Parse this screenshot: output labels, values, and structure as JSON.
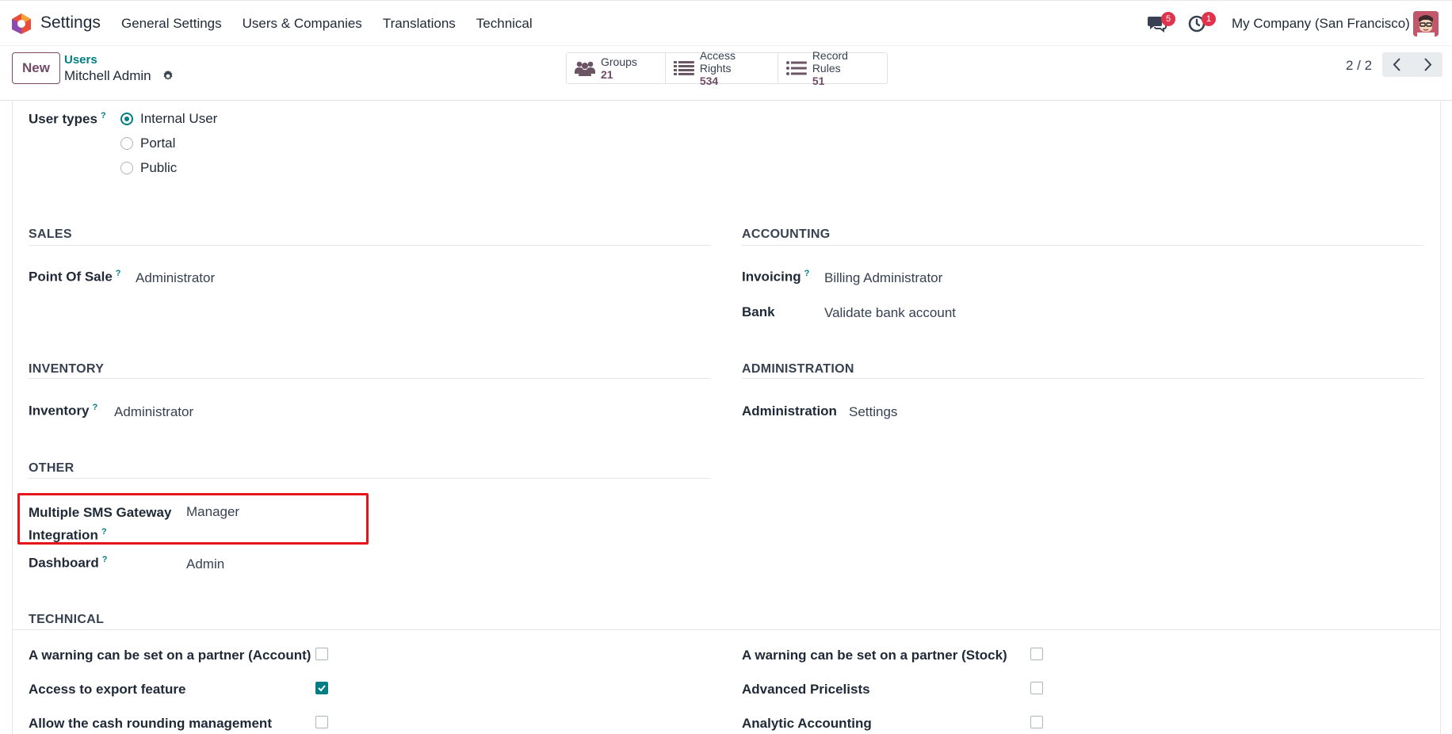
{
  "navbar": {
    "app_title": "Settings",
    "menu": [
      "General Settings",
      "Users & Companies",
      "Translations",
      "Technical"
    ],
    "chat_count": "5",
    "activity_count": "1",
    "company": "My Company (San Francisco)"
  },
  "control": {
    "new_label": "New",
    "breadcrumb_parent": "Users",
    "breadcrumb_current": "Mitchell Admin",
    "smart_buttons": [
      {
        "label": "Groups",
        "count": "21",
        "icon": "users-icon"
      },
      {
        "label": "Access Rights",
        "count": "534",
        "icon": "list-icon"
      },
      {
        "label": "Record Rules",
        "count": "51",
        "icon": "list-icon"
      }
    ],
    "pager": "2 / 2"
  },
  "form": {
    "user_types_label": "User types",
    "help_mark": "?",
    "user_types": [
      {
        "label": "Internal User",
        "selected": true
      },
      {
        "label": "Portal",
        "selected": false
      },
      {
        "label": "Public",
        "selected": false
      }
    ],
    "sales": {
      "title": "SALES",
      "point_of_sale_label": "Point Of Sale",
      "point_of_sale_value": "Administrator"
    },
    "accounting": {
      "title": "ACCOUNTING",
      "invoicing_label": "Invoicing",
      "invoicing_value": "Billing Administrator",
      "bank_label": "Bank",
      "bank_value": "Validate bank account"
    },
    "inventory": {
      "title": "INVENTORY",
      "inventory_label": "Inventory",
      "inventory_value": "Administrator"
    },
    "administration": {
      "title": "ADMINISTRATION",
      "administration_label": "Administration",
      "administration_value": "Settings"
    },
    "other": {
      "title": "OTHER",
      "sms_label_line1": "Multiple SMS Gateway",
      "sms_label_line2": "Integration",
      "sms_value": "Manager",
      "dashboard_label": "Dashboard",
      "dashboard_value": "Admin"
    },
    "technical": {
      "title": "TECHNICAL",
      "left": [
        {
          "label": "A warning can be set on a partner (Account)",
          "checked": false
        },
        {
          "label": "Access to export feature",
          "checked": true
        },
        {
          "label": "Allow the cash rounding management",
          "checked": false
        }
      ],
      "right": [
        {
          "label": "A warning can be set on a partner (Stock)",
          "checked": false
        },
        {
          "label": "Advanced Pricelists",
          "checked": false
        },
        {
          "label": "Analytic Accounting",
          "checked": false
        }
      ]
    }
  },
  "colors": {
    "brand": "#714b67",
    "accent": "#017e84",
    "highlight": "#e5141b",
    "badge": "#e0334d"
  }
}
